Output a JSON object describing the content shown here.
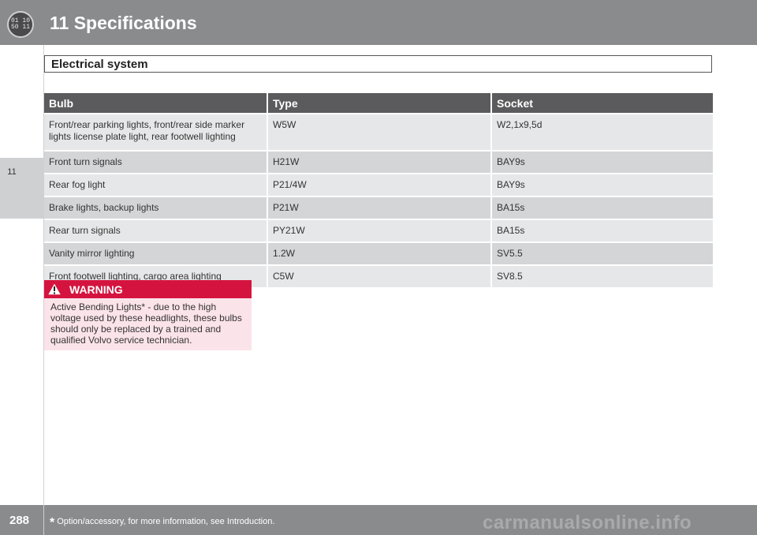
{
  "header": {
    "chapter_icon_text_top": "01 10",
    "chapter_icon_text_bottom": "50 11",
    "title": "11 Specifications"
  },
  "side_tab": {
    "label": "11"
  },
  "section": {
    "title": "Electrical system"
  },
  "table": {
    "headers": [
      "Bulb",
      "Type",
      "Socket"
    ],
    "rows": [
      {
        "bulb": "Front/rear parking lights, front/rear side marker lights license plate light, rear footwell lighting",
        "type": "W5W",
        "socket": "W2,1x9,5d"
      },
      {
        "bulb": "Front turn signals",
        "type": "H21W",
        "socket": "BAY9s"
      },
      {
        "bulb": "Rear fog light",
        "type": "P21/4W",
        "socket": "BAY9s"
      },
      {
        "bulb": "Brake lights, backup lights",
        "type": "P21W",
        "socket": "BA15s"
      },
      {
        "bulb": "Rear turn signals",
        "type": "PY21W",
        "socket": "BA15s"
      },
      {
        "bulb": "Vanity mirror lighting",
        "type": "1.2W",
        "socket": "SV5.5"
      },
      {
        "bulb": "Front footwell lighting, cargo area lighting",
        "type": "C5W",
        "socket": "SV8.5"
      }
    ]
  },
  "warning": {
    "title": "WARNING",
    "body": "Active Bending Lights* - due to the high voltage used by these headlights, these bulbs should only be replaced by a trained and qualified Volvo service technician."
  },
  "footer": {
    "page_number": "288",
    "footnote_star": "*",
    "footnote": "Option/accessory, for more information, see Introduction.",
    "watermark": "carmanualsonline.info"
  },
  "colors": {
    "header_bg": "#8a8b8d",
    "table_header_bg": "#5b5b5d",
    "row_light": "#e6e7e8",
    "row_dark": "#d4d5d6",
    "warning_red": "#d4143f",
    "warning_bg": "#fbe3ea"
  },
  "icons": {
    "chapter": "chapter-badge-icon",
    "warning": "warning-triangle-icon"
  }
}
